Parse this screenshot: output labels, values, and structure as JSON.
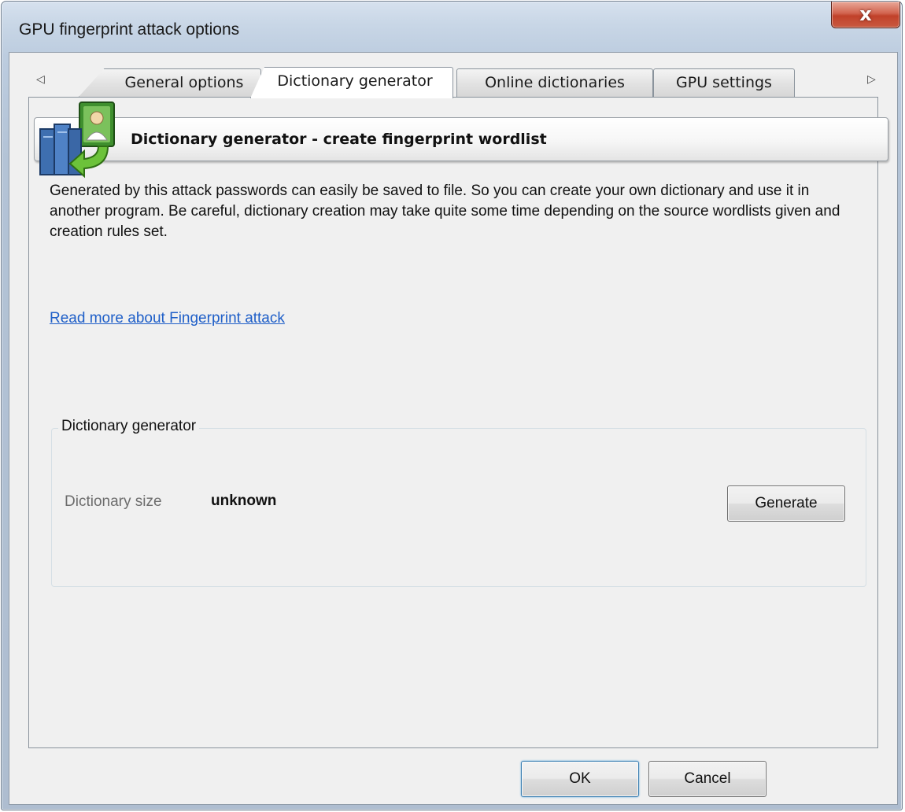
{
  "window": {
    "title": "GPU fingerprint attack options",
    "close_glyph": "x"
  },
  "tabs": {
    "scroll_left_glyph": "◁",
    "scroll_right_glyph": "▷",
    "items": [
      {
        "label": "General options",
        "active": false
      },
      {
        "label": "Dictionary generator",
        "active": true
      },
      {
        "label": "Online dictionaries",
        "active": false
      },
      {
        "label": "GPU settings",
        "active": false
      }
    ]
  },
  "banner": {
    "icon": "dictionary-books-user-icon",
    "title": "Dictionary generator - create fingerprint wordlist"
  },
  "description": "Generated by this attack passwords can easily be saved to file. So you can create your own dictionary and use it in another program. Be careful, dictionary creation may take quite some time depending on the source wordlists given and creation rules set.",
  "read_more_link": "Read more about Fingerprint attack",
  "generator_group": {
    "legend": "Dictionary generator",
    "size_label": "Dictionary size",
    "size_value": "unknown",
    "generate_label": "Generate"
  },
  "footer": {
    "ok_label": "OK",
    "cancel_label": "Cancel"
  },
  "colors": {
    "link": "#1f5fc8",
    "dialog_background": "#f0f0f0",
    "close_button": "#c1412a"
  }
}
